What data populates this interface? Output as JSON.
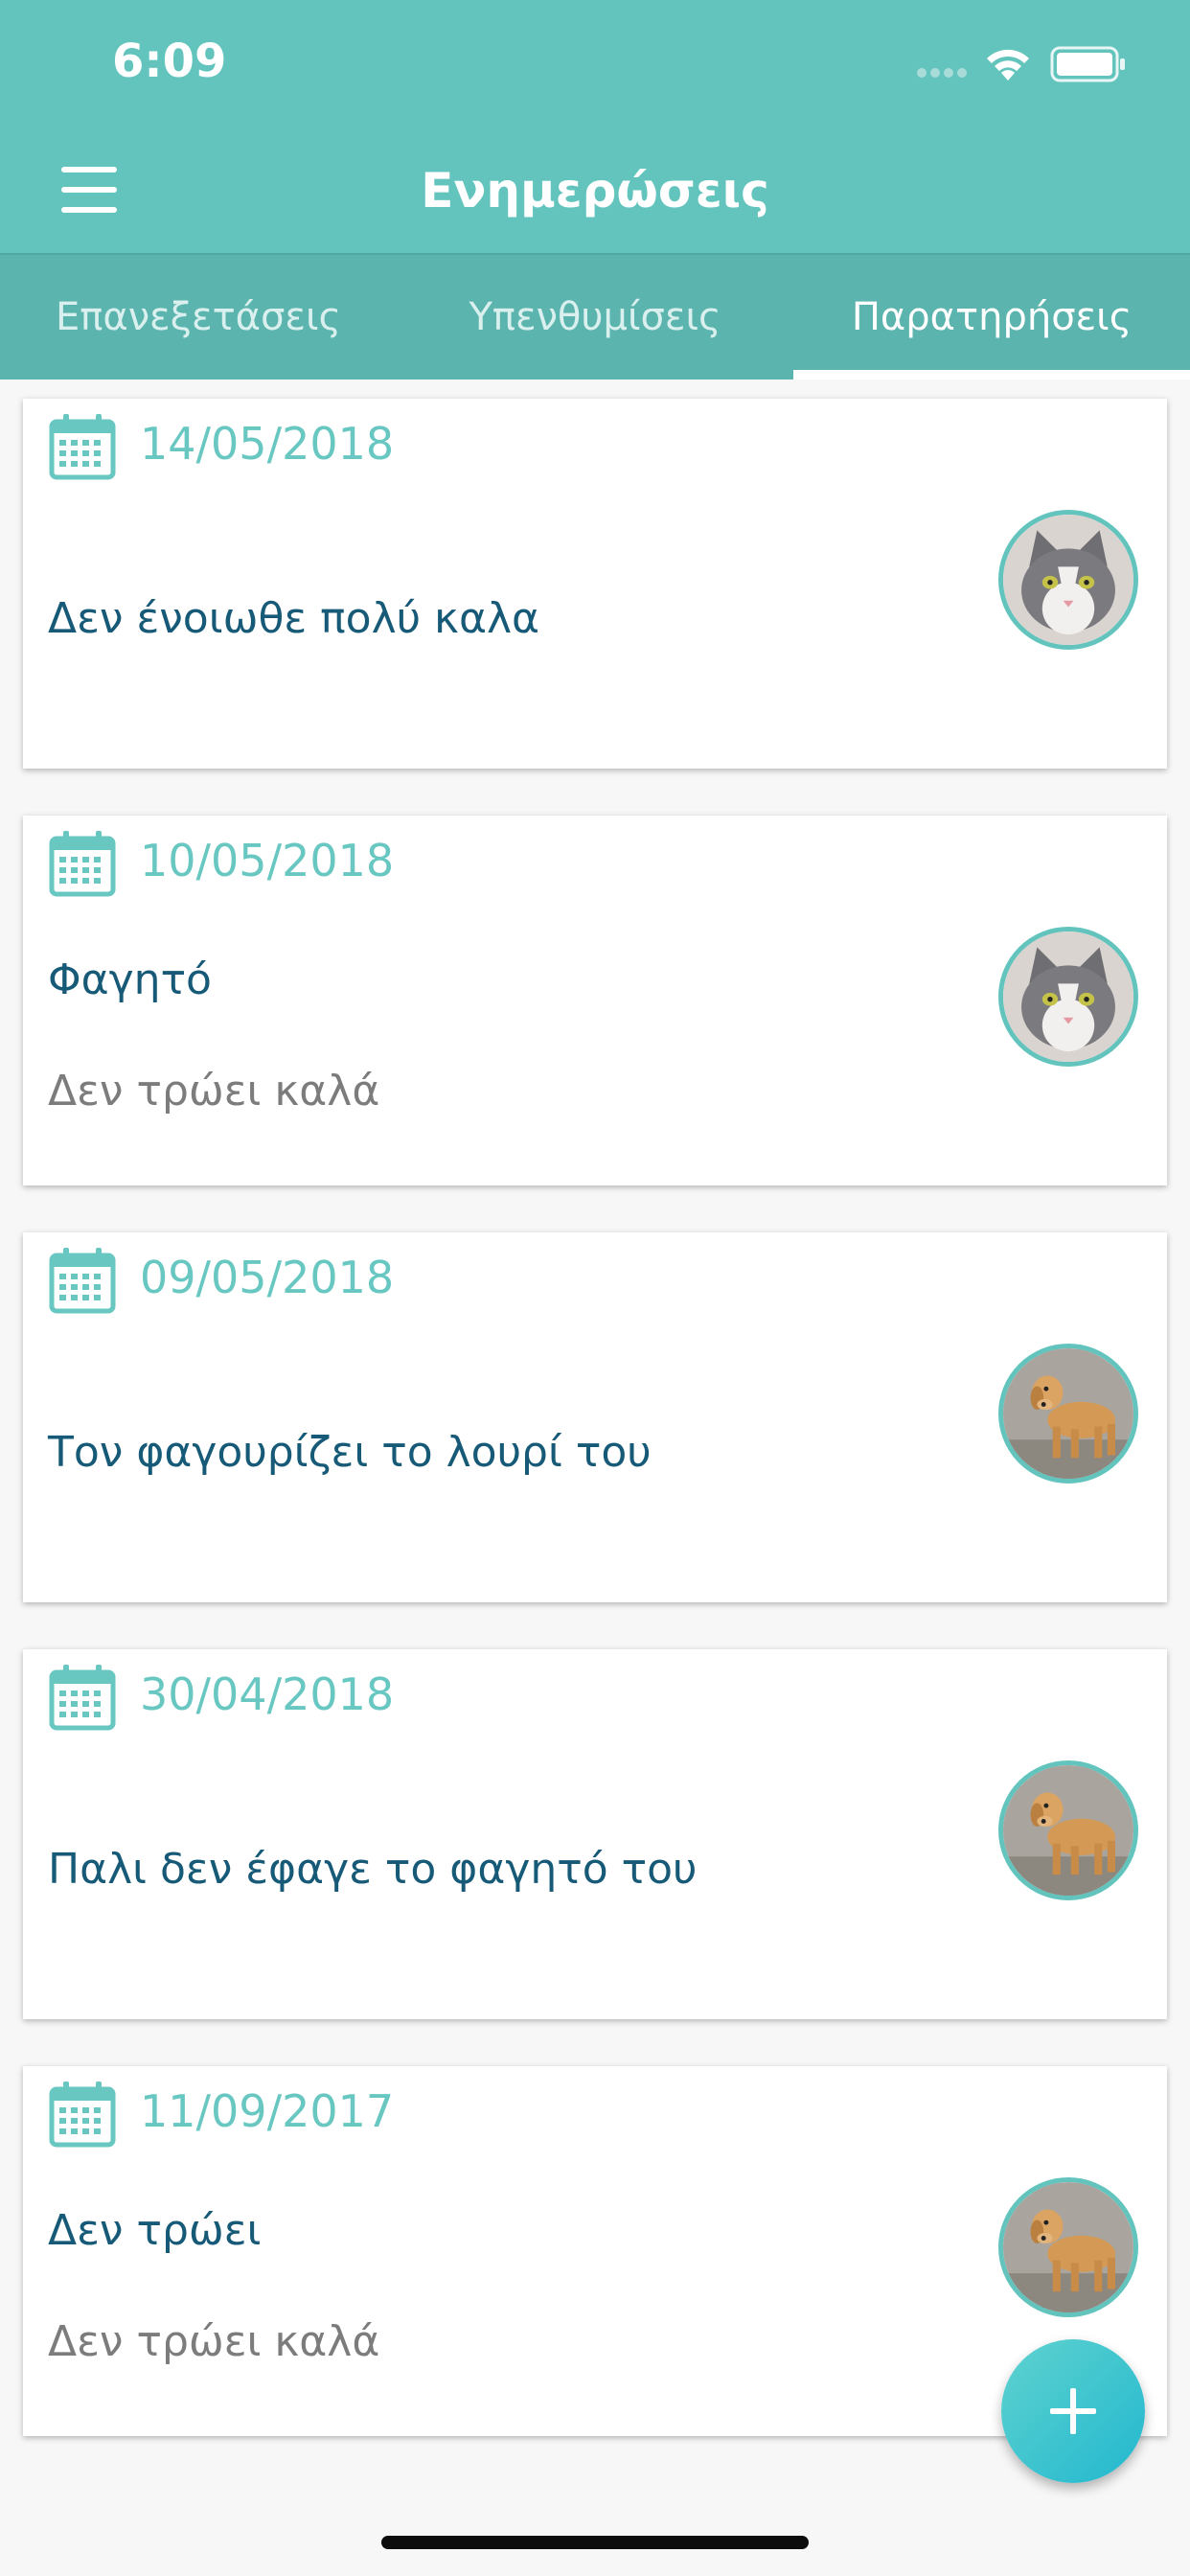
{
  "status_bar": {
    "time": "6:09"
  },
  "nav": {
    "title": "Ενημερώσεις",
    "menu_icon": "hamburger-menu-icon"
  },
  "tabs": [
    {
      "label": "Επανεξετάσεις",
      "active": false
    },
    {
      "label": "Υπενθυμίσεις",
      "active": false
    },
    {
      "label": "Παρατηρήσεις",
      "active": true
    }
  ],
  "cards": [
    {
      "date": "14/05/2018",
      "title": "Δεν ένοιωθε πολύ καλα",
      "subtitle": "",
      "pet": "cat"
    },
    {
      "date": "10/05/2018",
      "title": "Φαγητό",
      "subtitle": "Δεν τρώει καλά",
      "pet": "cat"
    },
    {
      "date": "09/05/2018",
      "title": "Τον φαγουρίζει το λουρί του",
      "subtitle": "",
      "pet": "dog"
    },
    {
      "date": "30/04/2018",
      "title": "Παλι δεν έφαγε το φαγητό του",
      "subtitle": "",
      "pet": "dog"
    },
    {
      "date": "11/09/2017",
      "title": "Δεν τρώει",
      "subtitle": "Δεν τρώει καλά",
      "pet": "dog"
    }
  ],
  "colors": {
    "primary": "#63c4bd",
    "title_text": "#165a77",
    "date_text": "#68c7c1"
  },
  "fab": {
    "icon": "plus-icon"
  }
}
